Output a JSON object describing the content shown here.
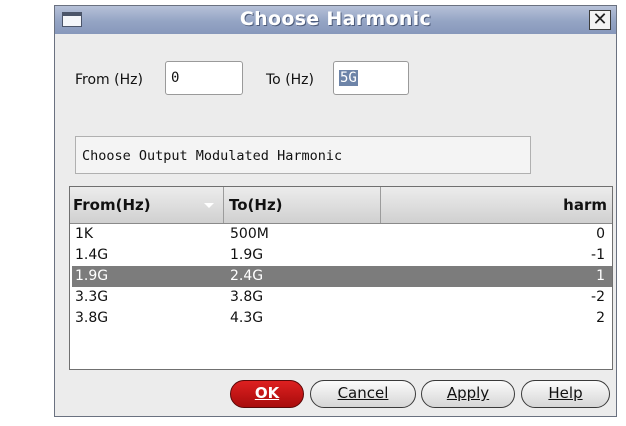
{
  "dialog": {
    "title": "Choose Harmonic"
  },
  "range": {
    "from_label": "From (Hz)",
    "from_value": "0",
    "to_label": "To (Hz)",
    "to_value": "5G"
  },
  "panel": {
    "label": "Choose Output Modulated Harmonic"
  },
  "table": {
    "columns": [
      "From(Hz)",
      "To(Hz)",
      "harm"
    ],
    "rows": [
      {
        "from": "1K",
        "to": "500M",
        "harm": "0"
      },
      {
        "from": "1.4G",
        "to": "1.9G",
        "harm": "-1"
      },
      {
        "from": "1.9G",
        "to": "2.4G",
        "harm": "1"
      },
      {
        "from": "3.3G",
        "to": "3.8G",
        "harm": "-2"
      },
      {
        "from": "3.8G",
        "to": "4.3G",
        "harm": "2"
      }
    ],
    "selected_row": 2
  },
  "buttons": {
    "ok": "OK",
    "cancel": "Cancel",
    "apply": "Apply",
    "help": "Help"
  },
  "icons": {
    "window": "window-icon",
    "close": "close-icon",
    "sort": "sort-down-icon"
  },
  "colors": {
    "title_bar": "#94a4c4",
    "selected_row": "#7c7c7c",
    "ok_button": "#c41515"
  }
}
